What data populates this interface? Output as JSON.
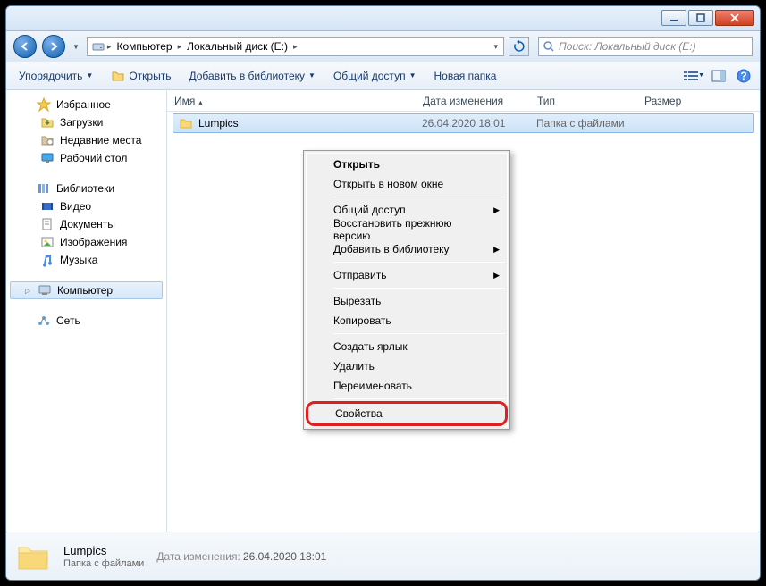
{
  "breadcrumb": {
    "root": "Компьютер",
    "disk": "Локальный диск (E:)"
  },
  "search": {
    "placeholder": "Поиск: Локальный диск (E:)"
  },
  "toolbar": {
    "organize": "Упорядочить",
    "open": "Открыть",
    "add_lib": "Добавить в библиотеку",
    "share": "Общий доступ",
    "new_folder": "Новая папка"
  },
  "sidebar": {
    "favorites": "Избранное",
    "downloads": "Загрузки",
    "recent": "Недавние места",
    "desktop": "Рабочий стол",
    "libraries": "Библиотеки",
    "video": "Видео",
    "documents": "Документы",
    "images": "Изображения",
    "music": "Музыка",
    "computer": "Компьютер",
    "network": "Сеть"
  },
  "columns": {
    "name": "Имя",
    "date": "Дата изменения",
    "type": "Тип",
    "size": "Размер"
  },
  "file": {
    "name": "Lumpics",
    "date": "26.04.2020 18:01",
    "type": "Папка с файлами"
  },
  "context": {
    "open": "Открыть",
    "open_new": "Открыть в новом окне",
    "share": "Общий доступ",
    "restore": "Восстановить прежнюю версию",
    "add_lib": "Добавить в библиотеку",
    "send_to": "Отправить",
    "cut": "Вырезать",
    "copy": "Копировать",
    "shortcut": "Создать ярлык",
    "delete": "Удалить",
    "rename": "Переименовать",
    "properties": "Свойства"
  },
  "details": {
    "name": "Lumpics",
    "type": "Папка с файлами",
    "date_label": "Дата изменения:",
    "date": "26.04.2020 18:01"
  }
}
